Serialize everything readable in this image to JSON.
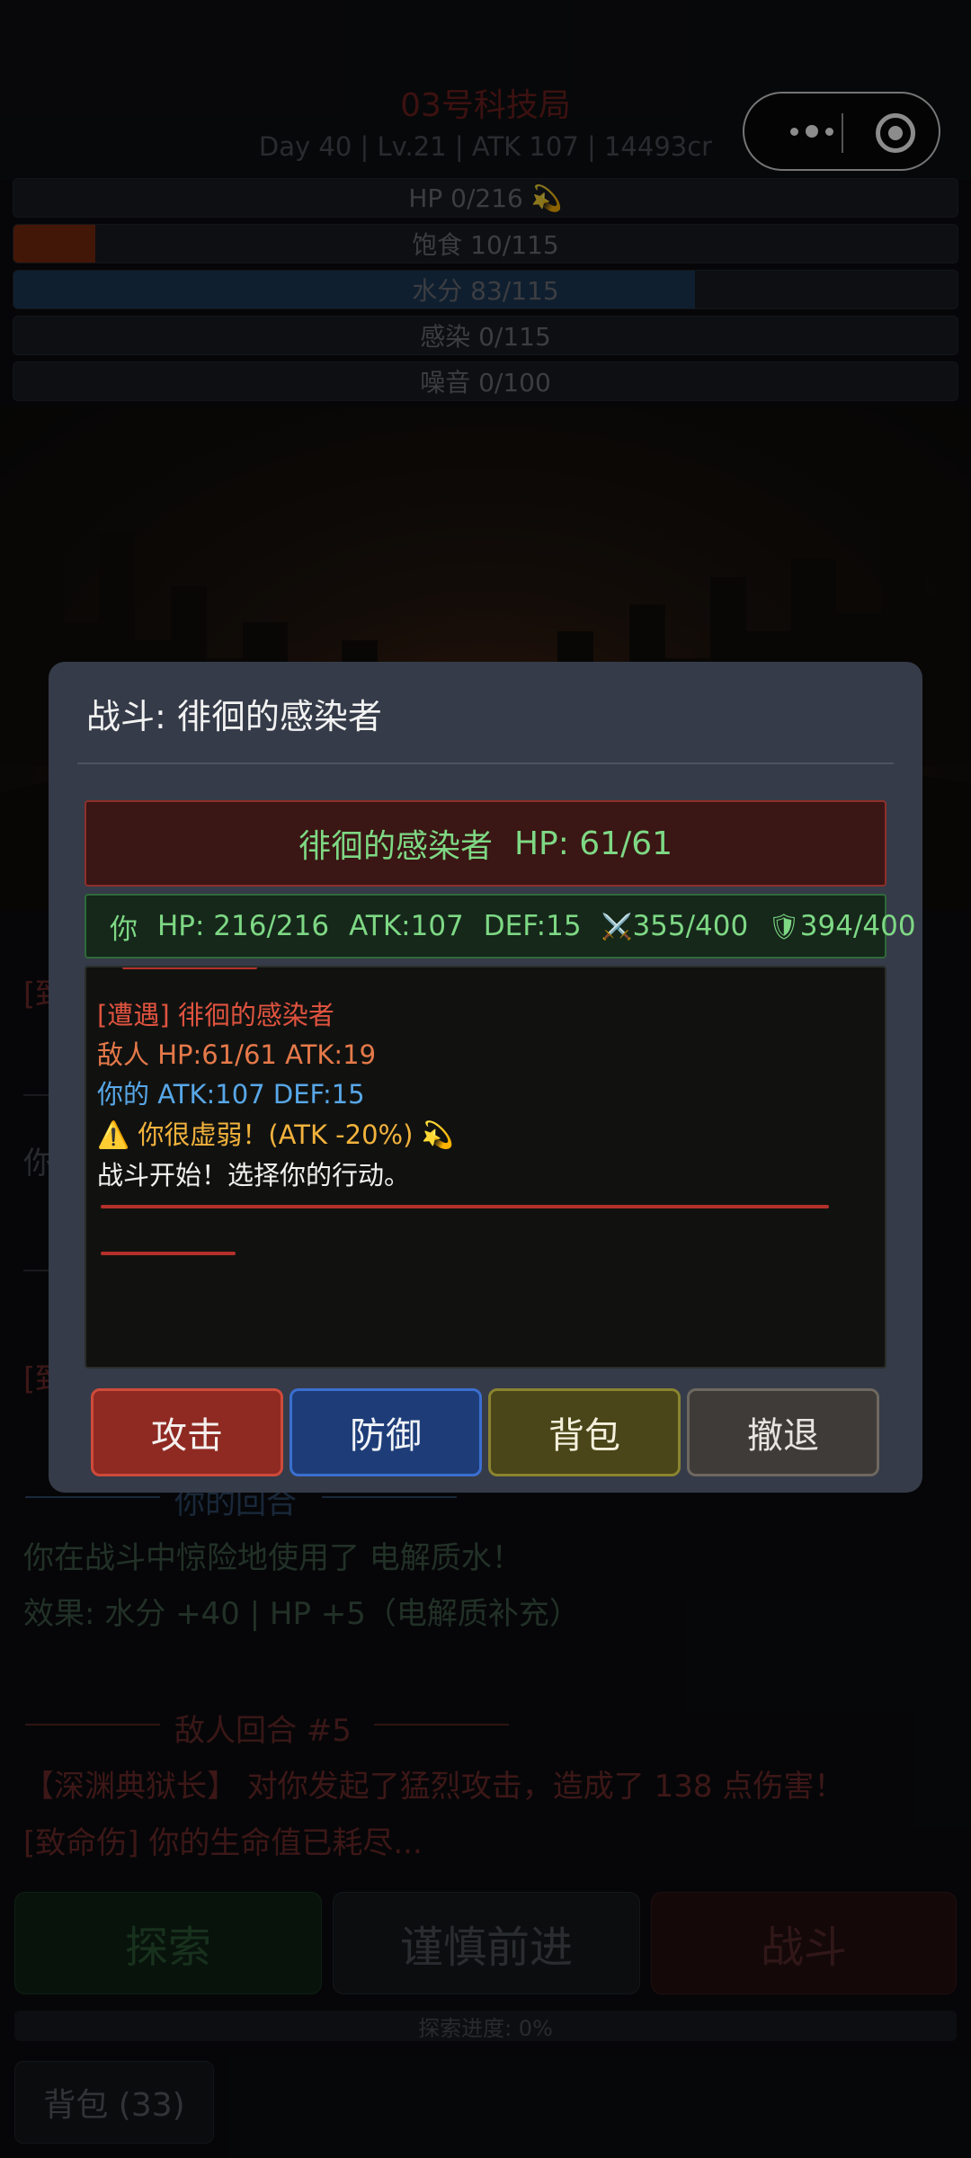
{
  "header": {
    "title": "03号科技局",
    "subtitle": "Day 40 | Lv.21 | ATK 107 | 14493cr"
  },
  "stats": [
    {
      "label": "HP 0/216 💫",
      "fill": 0,
      "color": "#8a2a1a"
    },
    {
      "label": "饱食 10/115",
      "fill": 0.087,
      "color": "#7a2a10"
    },
    {
      "label": "水分 83/115",
      "fill": 0.722,
      "color": "#1c3a56"
    },
    {
      "label": "感染 0/115",
      "fill": 0,
      "color": "#3a5a2a"
    },
    {
      "label": "噪音 0/100",
      "fill": 0,
      "color": "#5a4a2a"
    }
  ],
  "log": {
    "frag1": "[致",
    "frag2": "你",
    "frag3": "[致",
    "section_your_turn": "你的回合",
    "used_item": "你在战斗中惊险地使用了 电解质水！",
    "effect": "效果: 水分 +40 | HP +5（电解质补充）",
    "section_enemy_turn": "敌人回合 #5",
    "enemy_attack": "【深渊典狱长】 对你发起了猛烈攻击，造成了 138 点伤害！",
    "fatal": "[致命伤] 你的生命值已耗尽..."
  },
  "actions": {
    "explore": "探索",
    "careful": "谨慎前进",
    "fight": "战斗"
  },
  "progress": "探索进度: 0%",
  "bag": "背包 (33)",
  "modal": {
    "title": "战斗: 徘徊的感染者",
    "enemy_name": "徘徊的感染者",
    "enemy_hp": "HP: 61/61",
    "player": {
      "you": "你",
      "hp": "HP: 216/216",
      "atk": "ATK:107",
      "def": "DEF:15",
      "sword_icon": "⚔️",
      "weapon": "355/400",
      "shield_icon": "🛡",
      "armor": "394/400"
    },
    "battle_log": [
      {
        "text": "[遭遇] 徘徊的感染者",
        "color": "#e0533f"
      },
      {
        "text": "敌人 HP:61/61 ATK:19",
        "color": "#e6794a"
      },
      {
        "text": "你的 ATK:107 DEF:15",
        "color": "#58a7e8"
      },
      {
        "text": "⚠️ 你很虚弱！(ATK -20%) 💫",
        "color": "#f2b23c"
      },
      {
        "text": "战斗开始！选择你的行动。",
        "color": "#f0f0f0"
      }
    ],
    "buttons": {
      "attack": "攻击",
      "defend": "防御",
      "bag": "背包",
      "retreat": "撤退"
    }
  }
}
